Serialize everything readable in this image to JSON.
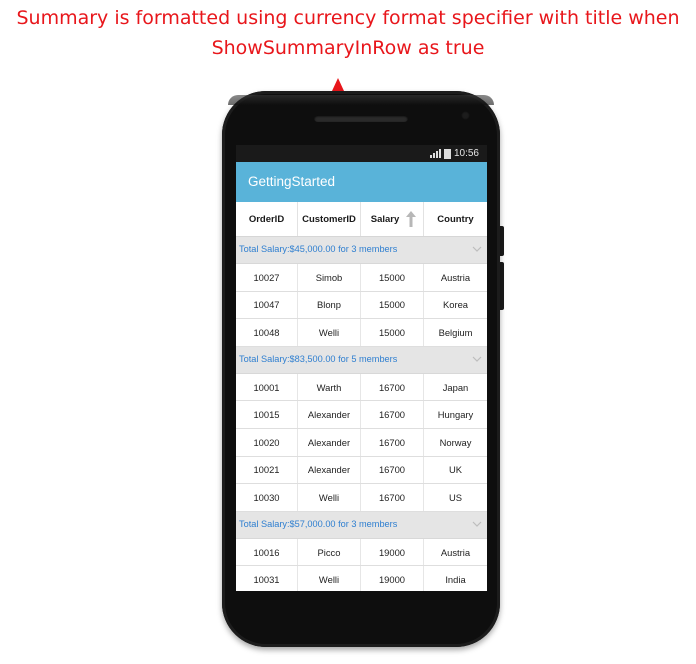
{
  "annotation": {
    "line1": "Summary is formatted using  currency format specifier with title when",
    "line2": "ShowSummaryInRow as true",
    "color": "#e8161b"
  },
  "status_bar": {
    "time": "10:56",
    "icons": [
      "signal-icon",
      "battery-icon"
    ]
  },
  "app": {
    "title": "GettingStarted",
    "accent": "#59b3d9"
  },
  "grid": {
    "columns": [
      "OrderID",
      "CustomerID",
      "Salary",
      "Country"
    ],
    "sorted_column": "Salary",
    "sort_direction": "ascending",
    "groups": [
      {
        "summary": "Total Salary:$45,000.00 for 3 members",
        "rows": [
          [
            "10027",
            "Simob",
            "15000",
            "Austria"
          ],
          [
            "10047",
            "Blonp",
            "15000",
            "Korea"
          ],
          [
            "10048",
            "Welli",
            "15000",
            "Belgium"
          ]
        ]
      },
      {
        "summary": "Total Salary:$83,500.00 for 5 members",
        "rows": [
          [
            "10001",
            "Warth",
            "16700",
            "Japan"
          ],
          [
            "10015",
            "Alexander",
            "16700",
            "Hungary"
          ],
          [
            "10020",
            "Alexander",
            "16700",
            "Norway"
          ],
          [
            "10021",
            "Alexander",
            "16700",
            "UK"
          ],
          [
            "10030",
            "Welli",
            "16700",
            "US"
          ]
        ]
      },
      {
        "summary": "Total Salary:$57,000.00 for 3 members",
        "rows": [
          [
            "10016",
            "Picco",
            "19000",
            "Austria"
          ],
          [
            "10031",
            "Welli",
            "19000",
            "India"
          ]
        ]
      }
    ],
    "summary_text_color": "#2f7fd0"
  }
}
